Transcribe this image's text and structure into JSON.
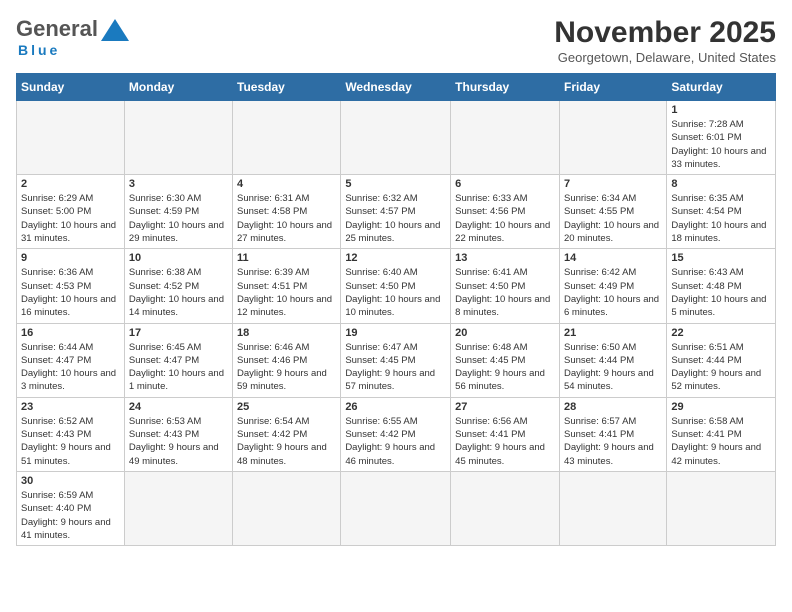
{
  "header": {
    "logo_general": "General",
    "logo_blue": "Blue",
    "logo_tagline": "Blue",
    "title": "November 2025",
    "subtitle": "Georgetown, Delaware, United States"
  },
  "calendar": {
    "days_of_week": [
      "Sunday",
      "Monday",
      "Tuesday",
      "Wednesday",
      "Thursday",
      "Friday",
      "Saturday"
    ],
    "weeks": [
      [
        {
          "day": "",
          "info": ""
        },
        {
          "day": "",
          "info": ""
        },
        {
          "day": "",
          "info": ""
        },
        {
          "day": "",
          "info": ""
        },
        {
          "day": "",
          "info": ""
        },
        {
          "day": "",
          "info": ""
        },
        {
          "day": "1",
          "info": "Sunrise: 7:28 AM\nSunset: 6:01 PM\nDaylight: 10 hours and 33 minutes."
        }
      ],
      [
        {
          "day": "2",
          "info": "Sunrise: 6:29 AM\nSunset: 5:00 PM\nDaylight: 10 hours and 31 minutes."
        },
        {
          "day": "3",
          "info": "Sunrise: 6:30 AM\nSunset: 4:59 PM\nDaylight: 10 hours and 29 minutes."
        },
        {
          "day": "4",
          "info": "Sunrise: 6:31 AM\nSunset: 4:58 PM\nDaylight: 10 hours and 27 minutes."
        },
        {
          "day": "5",
          "info": "Sunrise: 6:32 AM\nSunset: 4:57 PM\nDaylight: 10 hours and 25 minutes."
        },
        {
          "day": "6",
          "info": "Sunrise: 6:33 AM\nSunset: 4:56 PM\nDaylight: 10 hours and 22 minutes."
        },
        {
          "day": "7",
          "info": "Sunrise: 6:34 AM\nSunset: 4:55 PM\nDaylight: 10 hours and 20 minutes."
        },
        {
          "day": "8",
          "info": "Sunrise: 6:35 AM\nSunset: 4:54 PM\nDaylight: 10 hours and 18 minutes."
        }
      ],
      [
        {
          "day": "9",
          "info": "Sunrise: 6:36 AM\nSunset: 4:53 PM\nDaylight: 10 hours and 16 minutes."
        },
        {
          "day": "10",
          "info": "Sunrise: 6:38 AM\nSunset: 4:52 PM\nDaylight: 10 hours and 14 minutes."
        },
        {
          "day": "11",
          "info": "Sunrise: 6:39 AM\nSunset: 4:51 PM\nDaylight: 10 hours and 12 minutes."
        },
        {
          "day": "12",
          "info": "Sunrise: 6:40 AM\nSunset: 4:50 PM\nDaylight: 10 hours and 10 minutes."
        },
        {
          "day": "13",
          "info": "Sunrise: 6:41 AM\nSunset: 4:50 PM\nDaylight: 10 hours and 8 minutes."
        },
        {
          "day": "14",
          "info": "Sunrise: 6:42 AM\nSunset: 4:49 PM\nDaylight: 10 hours and 6 minutes."
        },
        {
          "day": "15",
          "info": "Sunrise: 6:43 AM\nSunset: 4:48 PM\nDaylight: 10 hours and 5 minutes."
        }
      ],
      [
        {
          "day": "16",
          "info": "Sunrise: 6:44 AM\nSunset: 4:47 PM\nDaylight: 10 hours and 3 minutes."
        },
        {
          "day": "17",
          "info": "Sunrise: 6:45 AM\nSunset: 4:47 PM\nDaylight: 10 hours and 1 minute."
        },
        {
          "day": "18",
          "info": "Sunrise: 6:46 AM\nSunset: 4:46 PM\nDaylight: 9 hours and 59 minutes."
        },
        {
          "day": "19",
          "info": "Sunrise: 6:47 AM\nSunset: 4:45 PM\nDaylight: 9 hours and 57 minutes."
        },
        {
          "day": "20",
          "info": "Sunrise: 6:48 AM\nSunset: 4:45 PM\nDaylight: 9 hours and 56 minutes."
        },
        {
          "day": "21",
          "info": "Sunrise: 6:50 AM\nSunset: 4:44 PM\nDaylight: 9 hours and 54 minutes."
        },
        {
          "day": "22",
          "info": "Sunrise: 6:51 AM\nSunset: 4:44 PM\nDaylight: 9 hours and 52 minutes."
        }
      ],
      [
        {
          "day": "23",
          "info": "Sunrise: 6:52 AM\nSunset: 4:43 PM\nDaylight: 9 hours and 51 minutes."
        },
        {
          "day": "24",
          "info": "Sunrise: 6:53 AM\nSunset: 4:43 PM\nDaylight: 9 hours and 49 minutes."
        },
        {
          "day": "25",
          "info": "Sunrise: 6:54 AM\nSunset: 4:42 PM\nDaylight: 9 hours and 48 minutes."
        },
        {
          "day": "26",
          "info": "Sunrise: 6:55 AM\nSunset: 4:42 PM\nDaylight: 9 hours and 46 minutes."
        },
        {
          "day": "27",
          "info": "Sunrise: 6:56 AM\nSunset: 4:41 PM\nDaylight: 9 hours and 45 minutes."
        },
        {
          "day": "28",
          "info": "Sunrise: 6:57 AM\nSunset: 4:41 PM\nDaylight: 9 hours and 43 minutes."
        },
        {
          "day": "29",
          "info": "Sunrise: 6:58 AM\nSunset: 4:41 PM\nDaylight: 9 hours and 42 minutes."
        }
      ],
      [
        {
          "day": "30",
          "info": "Sunrise: 6:59 AM\nSunset: 4:40 PM\nDaylight: 9 hours and 41 minutes."
        },
        {
          "day": "",
          "info": ""
        },
        {
          "day": "",
          "info": ""
        },
        {
          "day": "",
          "info": ""
        },
        {
          "day": "",
          "info": ""
        },
        {
          "day": "",
          "info": ""
        },
        {
          "day": "",
          "info": ""
        }
      ]
    ]
  }
}
